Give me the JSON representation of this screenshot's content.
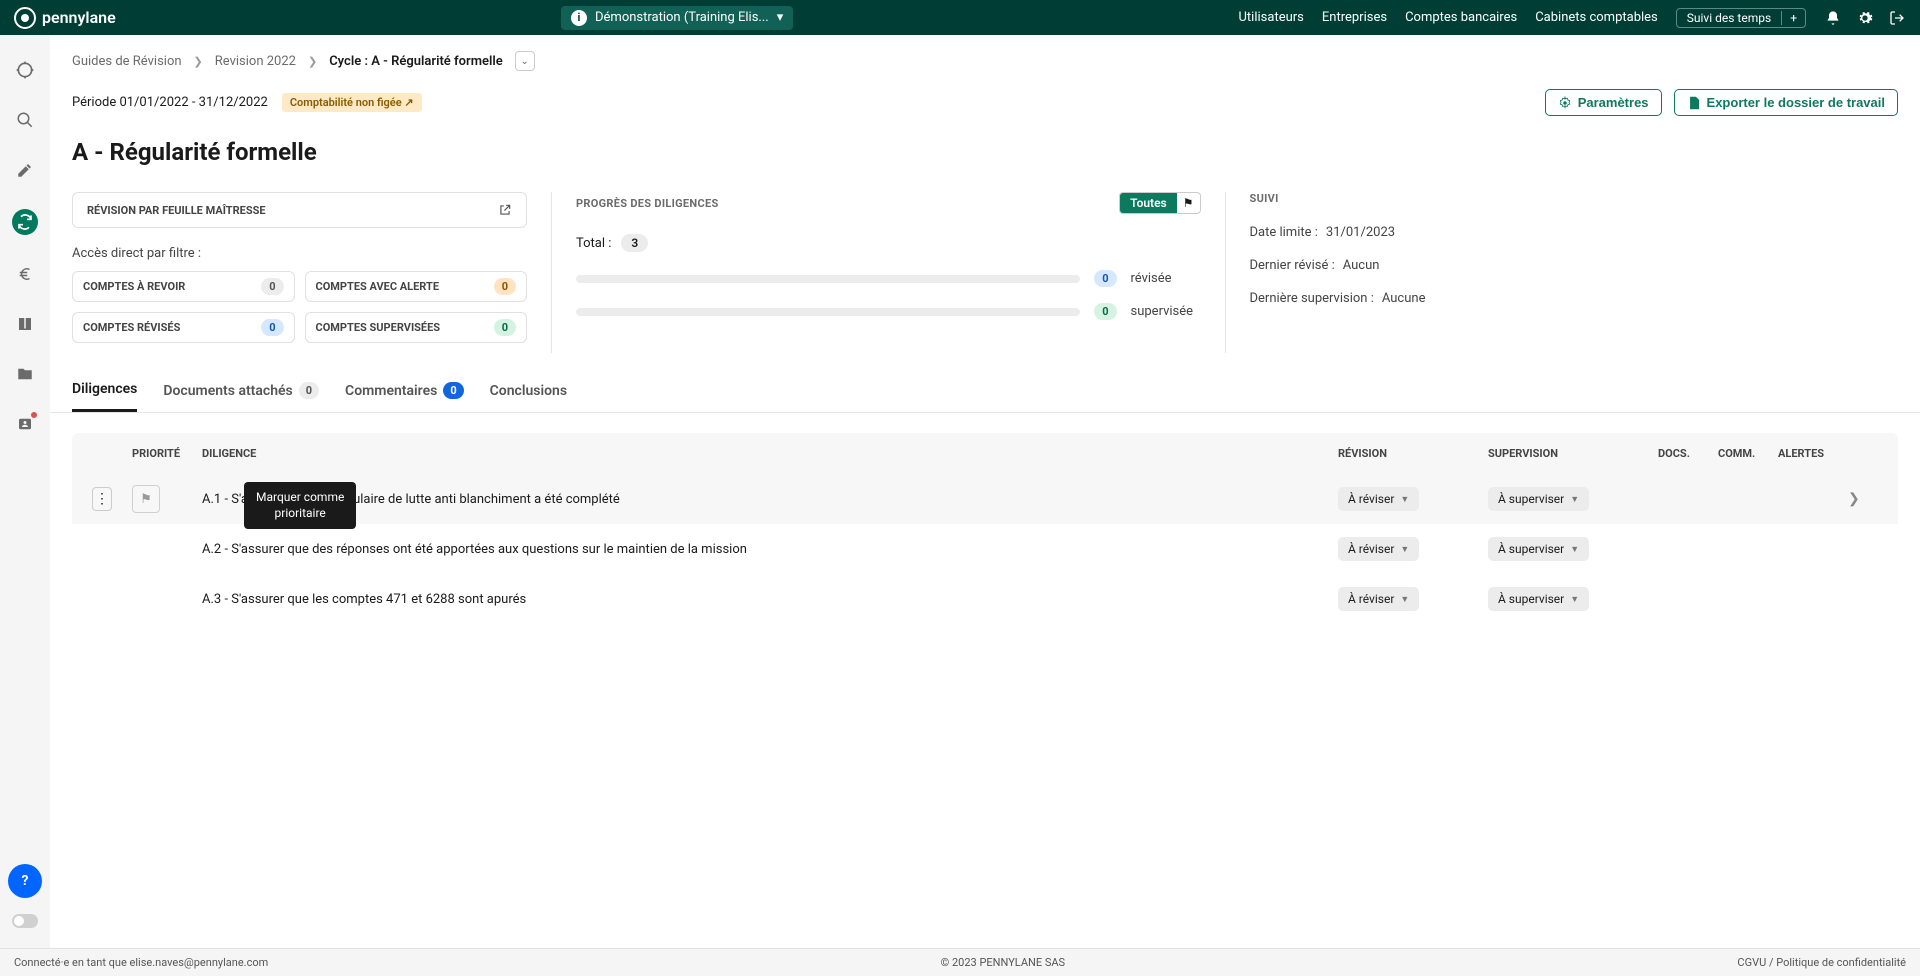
{
  "brand": "pennylane",
  "topbar": {
    "demo_label": "Démonstration (Training Elis...",
    "nav": {
      "users": "Utilisateurs",
      "companies": "Entreprises",
      "banks": "Comptes bancaires",
      "firms": "Cabinets comptables"
    },
    "time_tracking": "Suivi des temps",
    "plus": "+"
  },
  "breadcrumb": {
    "guides": "Guides de Révision",
    "revision": "Revision 2022",
    "cycle": "Cycle : A - Régularité formelle"
  },
  "period": {
    "text": "Période 01/01/2022 - 31/12/2022",
    "compta_badge": "Comptabilité non figée ↗"
  },
  "buttons": {
    "params": "Paramètres",
    "export": "Exporter le dossier de travail"
  },
  "page_title": "A - Régularité formelle",
  "revision_panel": {
    "header": "RÉVISION PAR FEUILLE MAÎTRESSE",
    "access": "Accès direct par filtre :",
    "filters": {
      "to_review": "COMPTES À REVOIR",
      "to_review_count": "0",
      "alert": "COMPTES AVEC ALERTE",
      "alert_count": "0",
      "reviewed": "COMPTES RÉVISÉS",
      "reviewed_count": "0",
      "supervised": "COMPTES SUPERVISÉES",
      "supervised_count": "0"
    }
  },
  "progress_panel": {
    "header": "PROGRÈS DES DILIGENCES",
    "toutes": "Toutes",
    "total_label": "Total :",
    "total_value": "3",
    "reviewed_count": "0",
    "reviewed_label": "révisée",
    "supervised_count": "0",
    "supervised_label": "supervisée"
  },
  "suivi_panel": {
    "header": "SUIVI",
    "deadline_k": "Date limite :",
    "deadline_v": "31/01/2023",
    "last_rev_k": "Dernier révisé :",
    "last_rev_v": "Aucun",
    "last_sup_k": "Dernière supervision :",
    "last_sup_v": "Aucune"
  },
  "tabs": {
    "diligences": "Diligences",
    "documents": "Documents attachés",
    "documents_count": "0",
    "comments": "Commentaires",
    "comments_count": "0",
    "conclusions": "Conclusions"
  },
  "table": {
    "headers": {
      "prio": "PRIORITÉ",
      "diligence": "DILIGENCE",
      "revision": "RÉVISION",
      "supervision": "SUPERVISION",
      "docs": "DOCS.",
      "comm": "COMM.",
      "alertes": "ALERTES"
    },
    "status_review": "À réviser",
    "status_supervise": "À superviser",
    "rows": [
      "A.1 - S'assurer que le formulaire de lutte anti blanchiment a été complété",
      "A.2 - S'assurer que des réponses ont été apportées aux questions sur le maintien de la mission",
      "A.3 - S'assurer que les comptes 471 et 6288 sont apurés"
    ],
    "tooltip": "Marquer comme\nprioritaire"
  },
  "footer": {
    "left": "Connecté·e en tant que elise.naves@pennylane.com",
    "center": "© 2023 PENNYLANE SAS",
    "cgvu": "CGVU",
    "sep": " / ",
    "privacy": "Politique de confidentialité"
  }
}
